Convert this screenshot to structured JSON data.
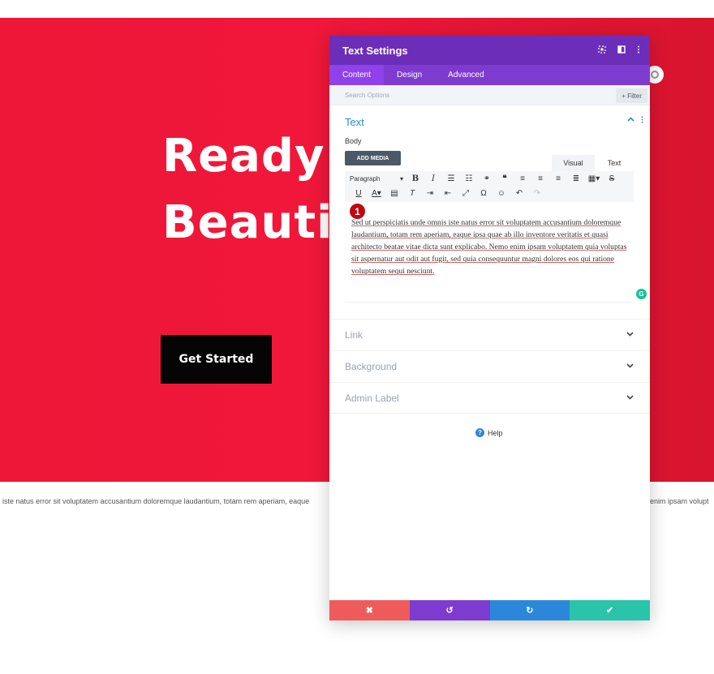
{
  "hero": {
    "title": "Ready t\nBeautif",
    "cta_label": "Get Started",
    "body_left": "iste natus error sit voluptatem accusantium doloremque laudantium, totam rem aperiam, eaque",
    "body_right": "enim ipsam volupt"
  },
  "modal": {
    "title": "Text Settings",
    "header_icons": [
      "expand-icon",
      "split-icon",
      "more-icon"
    ],
    "tabs": [
      {
        "label": "Content",
        "active": true
      },
      {
        "label": "Design",
        "active": false
      },
      {
        "label": "Advanced",
        "active": false
      }
    ],
    "search_placeholder": "Search Options",
    "filter_label": "+ Filter",
    "section": {
      "title": "Text",
      "body_label": "Body",
      "add_media_label": "ADD MEDIA",
      "editor_tab_visual": "Visual",
      "editor_tab_text": "Text",
      "format_select": "Paragraph",
      "editor_content": "Sed ut perspiciatis unde omnis iste natus error sit voluptatem accusantium doloremque laudantium, totam rem aperiam, eaque ipsa quae ab illo inventore veritatis et quasi architecto beatae vitae dicta sunt explicabo. Nemo enim ipsam voluptatem quia voluptas sit aspernatur aut odit aut fugit, sed quia consequuntur magni dolores eos qui ratione voluptatem sequi nesciunt.",
      "badge_number": "1",
      "grammarly_letter": "G"
    },
    "collapsed_sections": [
      {
        "label": "Link"
      },
      {
        "label": "Background"
      },
      {
        "label": "Admin Label"
      }
    ],
    "help_label": "Help",
    "help_icon_glyph": "?",
    "footer_buttons": [
      {
        "name": "cancel",
        "icon": "✖",
        "color": "#ef5b5b"
      },
      {
        "name": "undo",
        "icon": "↺",
        "color": "#7e3bd0"
      },
      {
        "name": "redo",
        "icon": "↻",
        "color": "#2b87da"
      },
      {
        "name": "save",
        "icon": "✔",
        "color": "#29c4a9"
      }
    ]
  },
  "colors": {
    "hero_red": "#ee1738",
    "header_purple": "#6c2eb9",
    "tab_purple": "#7e3bd0",
    "active_tab": "#8f42ec",
    "accent_blue": "#2b87da"
  }
}
